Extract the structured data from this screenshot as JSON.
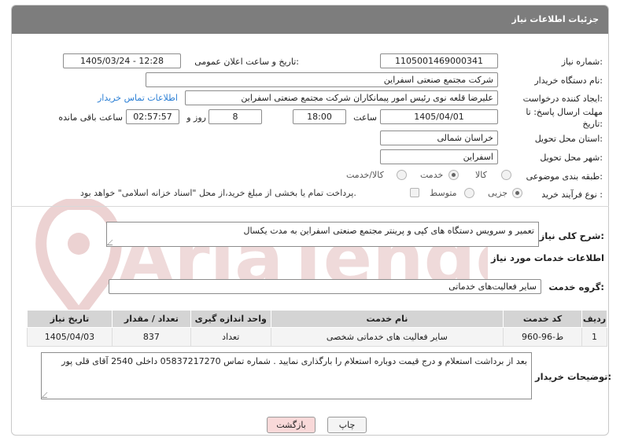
{
  "header": {
    "title": "جزئیات اطلاعات نیاز"
  },
  "fields": {
    "need_number_label": "شماره نیاز:",
    "need_number": "1105001469000341",
    "announce_label": "تاریخ و ساعت اعلان عمومی:",
    "announce_value": "1405/03/24 - 12:28",
    "buyer_org_label": "نام دستگاه خریدار:",
    "buyer_org": "شرکت مجتمع صنعتی اسفراین",
    "creator_label": "ایجاد کننده درخواست:",
    "creator": "علیرضا قلعه نوی رئیس امور پیمانکاران شرکت مجتمع صنعتی اسفراین",
    "contact_link": "اطلاعات تماس خریدار",
    "deadline_label_1": "مهلت ارسال پاسخ: تا",
    "deadline_label_2": "تاریخ:",
    "deadline_date": "1405/04/01",
    "time_label": "ساعت",
    "deadline_time": "18:00",
    "days_value": "8",
    "days_label": "روز و",
    "remaining_time": "02:57:57",
    "remaining_label": "ساعت باقی مانده",
    "province_label": "استان محل تحویل:",
    "province": "خراسان شمالی",
    "city_label": "شهر محل تحویل:",
    "city": "اسفراین",
    "category_label": "طبقه بندی موضوعی:",
    "category_options": [
      "کالا",
      "خدمت",
      "کالا/خدمت"
    ],
    "process_label": "نوع فرآیند خرید :",
    "process_options": [
      "جزیی",
      "متوسط"
    ],
    "payment_note": "پرداخت تمام یا بخشی از مبلغ خرید،از محل \"اسناد خزانه اسلامی\" خواهد بود."
  },
  "summary": {
    "label": "شرح کلی نیاز:",
    "value": "تعمیر و سرویس دستگاه های کپی و پرینتر مجتمع صنعتی اسفراین به مدت یکسال"
  },
  "services_section": {
    "title": "اطلاعات خدمات مورد نیاز",
    "group_label": "گروه خدمت:",
    "group_value": "سایر فعالیت‌های خدماتی"
  },
  "table": {
    "headers": [
      "ردیف",
      "کد خدمت",
      "نام خدمت",
      "واحد اندازه گیری",
      "تعداد / مقدار",
      "تاریخ نیاز"
    ],
    "rows": [
      [
        "1",
        "ط-96-960",
        "سایر فعالیت های خدماتی شخصی",
        "تعداد",
        "837",
        "1405/04/03"
      ]
    ]
  },
  "buyer_notes": {
    "label": "توضیحات خریدار:",
    "value": "بعد از برداشت استعلام و درج قیمت دوباره استعلام را بارگذاری نمایید . شماره تماس 05837217270 داخلی 2540 آقای قلی پور"
  },
  "buttons": {
    "print": "چاپ",
    "back": "بازگشت"
  },
  "watermark": {
    "text": "AriaTender.net"
  },
  "colors": {
    "header_bg": "#7d7d7d",
    "link": "#2b7fd5",
    "watermark": "#e8c9c9",
    "back_button_bg": "#f9d9d9"
  }
}
